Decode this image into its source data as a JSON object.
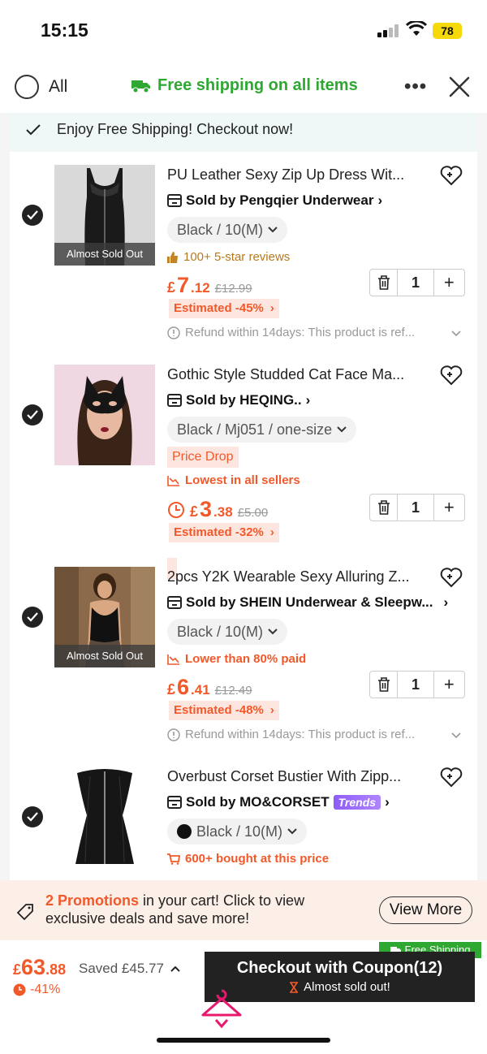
{
  "status": {
    "time": "15:15",
    "battery": "78"
  },
  "header": {
    "all_label": "All",
    "free_shipping": "Free shipping on all items"
  },
  "banner": {
    "text": "Enjoy Free Shipping! Checkout now!"
  },
  "items": [
    {
      "title": "PU Leather Sexy Zip Up Dress Wit...",
      "seller": "Sold by Pengqier Underwear",
      "variant": "Black / 10(M)",
      "badge": "Almost Sold Out",
      "reviews": "100+ 5-star reviews",
      "price_currency": "£",
      "price_int": "7",
      "price_dec": ".12",
      "original_price": "£12.99",
      "estimated": "Estimated -45%",
      "qty": "1",
      "refund": "Refund within 14days: This product is ref..."
    },
    {
      "title": "Gothic Style Studded Cat Face Ma...",
      "seller": "Sold by HEQING..",
      "variant": "Black / Mj051 / one-size",
      "price_drop": "Price Drop",
      "lowest": "Lowest in all sellers",
      "price_currency": "£",
      "price_int": "3",
      "price_dec": ".38",
      "original_price": "£5.00",
      "estimated": "Estimated -32%",
      "qty": "1"
    },
    {
      "title": "2pcs Y2K Wearable Sexy Alluring Z...",
      "seller": "Sold by SHEIN Underwear & Sleepw...",
      "variant": "Black / 10(M)",
      "badge": "Almost Sold Out",
      "lower": "Lower than 80% paid",
      "price_currency": "£",
      "price_int": "6",
      "price_dec": ".41",
      "original_price": "£12.49",
      "estimated": "Estimated -48%",
      "qty": "1",
      "refund": "Refund within 14days: This product is ref..."
    },
    {
      "title": "Overbust Corset Bustier With Zipp...",
      "seller": "Sold by MO&CORSET",
      "trends": "Trends",
      "variant": "Black / 10(M)",
      "bought": "600+ bought at this price"
    }
  ],
  "promo": {
    "highlight": "2 Promotions",
    "text": " in your cart! Click to view exclusive deals and save more!",
    "button": "View More"
  },
  "bottom": {
    "total_currency": "£",
    "total_int": "63",
    "total_dec": ".88",
    "saved": "Saved £45.77",
    "discount": "-41%",
    "free_shipping_badge": "Free Shipping",
    "checkout": "Checkout with Coupon(12)",
    "checkout_sub": "Almost sold out!"
  },
  "colors": {
    "accent": "#f1592a",
    "green": "#2fa832",
    "dark": "#222222"
  }
}
